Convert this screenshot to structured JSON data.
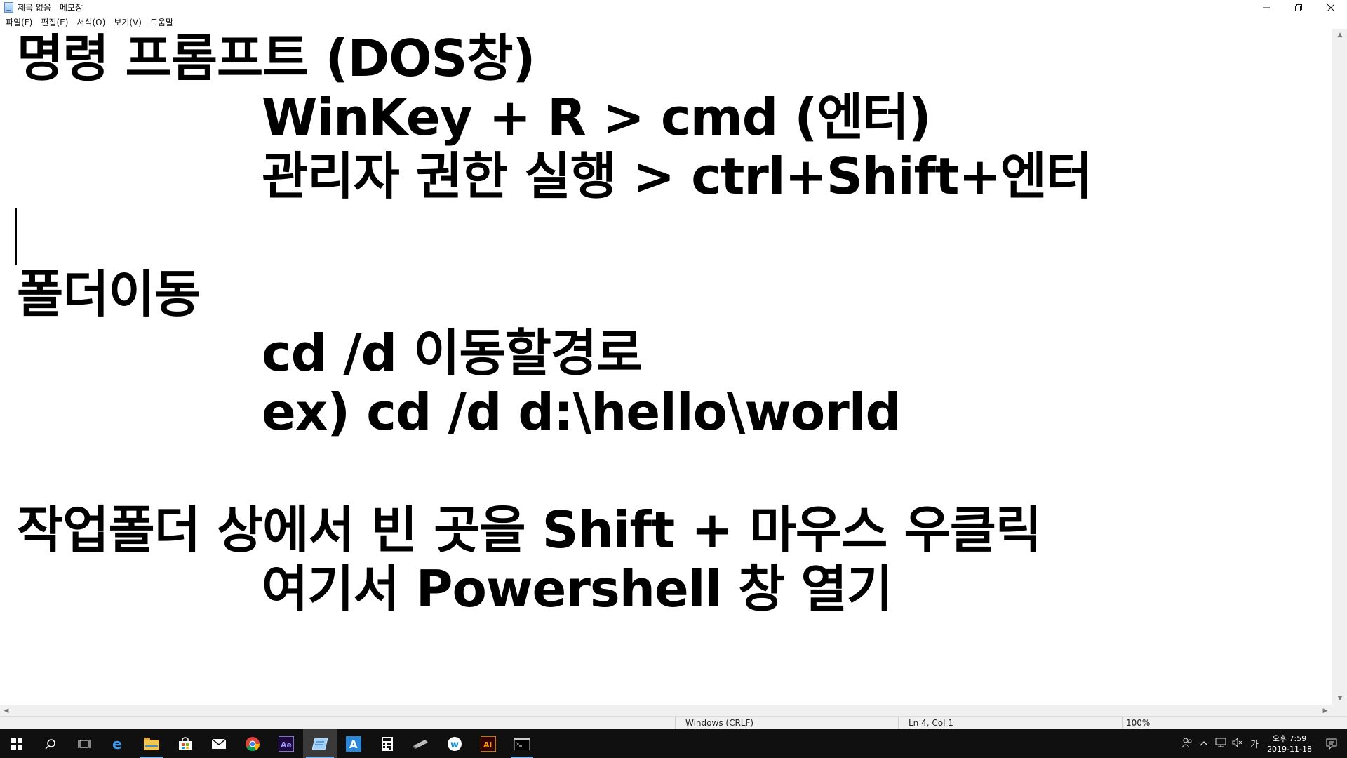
{
  "window": {
    "title": "제목 없음 - 메모장"
  },
  "menu": [
    "파일(F)",
    "편집(E)",
    "서식(O)",
    "보기(V)",
    "도움말"
  ],
  "document": {
    "lines": [
      "명령 프롬프트 (DOS창)",
      "WinKey + R > cmd (엔터)",
      "관리자 권한 실행 > ctrl+Shift+엔터",
      "",
      "폴더이동",
      "cd /d 이동할경로",
      "ex) cd /d d:\\hello\\world",
      "",
      "작업폴더 상에서 빈 곳을 Shift + 마우스 우클릭",
      "여기서 Powershell 창 열기"
    ]
  },
  "status": {
    "encoding": "Windows (CRLF)",
    "position": "Ln 4, Col 1",
    "zoom": "100%"
  },
  "taskbar": {
    "apps": [
      "start-icon",
      "search-icon",
      "task-view-icon",
      "edge-icon",
      "file-explorer-icon",
      "store-icon",
      "mail-icon",
      "chrome-icon",
      "after-effects-icon",
      "notepad-icon",
      "ms-store-a-icon",
      "calculator-icon",
      "pen-tablet-icon",
      "w-app-icon",
      "illustrator-icon",
      "command-prompt-icon"
    ],
    "ime_label": "가",
    "time": "오후 7:59",
    "date": "2019-11-18"
  },
  "colors": {
    "taskbar": "#101010",
    "accent": "#76b9ed"
  }
}
